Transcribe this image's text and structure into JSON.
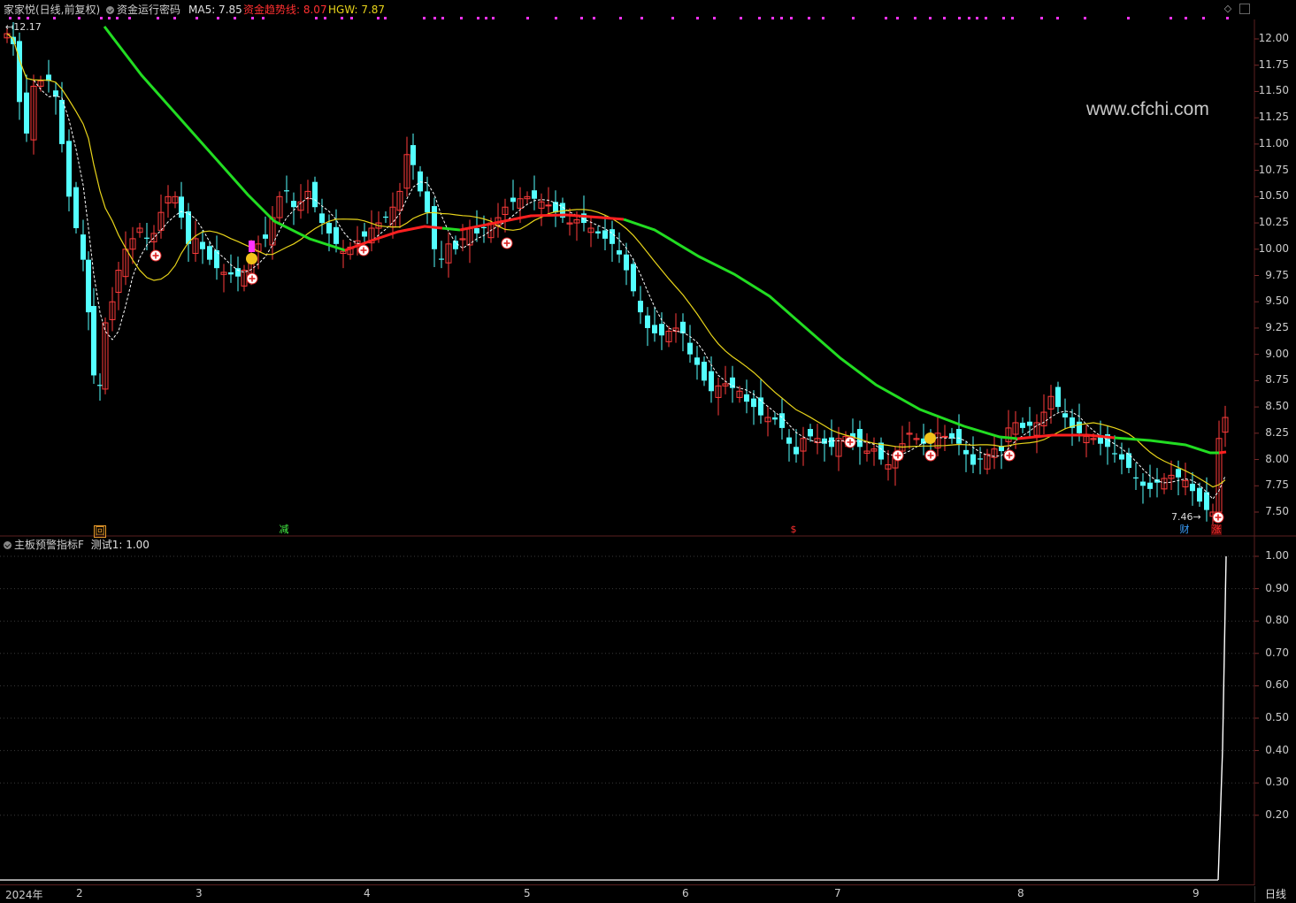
{
  "main_header": {
    "stock": "家家悦(日线,前复权)",
    "indicator": "资金运行密码",
    "ma5": "MA5: 7.85",
    "trend": "资金趋势线: 8.07",
    "hgw": "HGW: 7.87"
  },
  "sub_header": {
    "indicator": "主板预警指标F",
    "test": "测试1: 1.00"
  },
  "watermark": "www.cfchi.com",
  "price_axis": [
    "12.00",
    "11.75",
    "11.50",
    "11.25",
    "11.00",
    "10.75",
    "10.50",
    "10.25",
    "10.00",
    "9.75",
    "9.50",
    "9.25",
    "9.00",
    "8.75",
    "8.50",
    "8.25",
    "8.00",
    "7.75",
    "7.50"
  ],
  "sub_axis": [
    "1.00",
    "0.90",
    "0.80",
    "0.70",
    "0.60",
    "0.50",
    "0.40",
    "0.30",
    "0.20"
  ],
  "x_axis": [
    "2024年",
    "2",
    "3",
    "4",
    "5",
    "6",
    "7",
    "8",
    "9"
  ],
  "annotations": {
    "high": "12.17",
    "low": "7.46"
  },
  "signals": {
    "hui": "回",
    "jian": "减",
    "dollar": "$",
    "cai": "财",
    "zhang": "涨"
  },
  "period": "日线",
  "colors": {
    "up": "#ff3b3b",
    "down": "#54ffff",
    "trend_green": "#22dd22",
    "trend_red": "#ff2020",
    "ma_yellow": "#e8d41a",
    "magenta": "#ff33ff"
  },
  "chart_data": {
    "type": "line",
    "title": "",
    "series": [
      {
        "name": "测试1",
        "values": [
          0,
          0,
          0,
          0,
          0,
          0,
          0,
          0,
          0,
          0,
          0,
          0,
          1
        ]
      }
    ]
  }
}
